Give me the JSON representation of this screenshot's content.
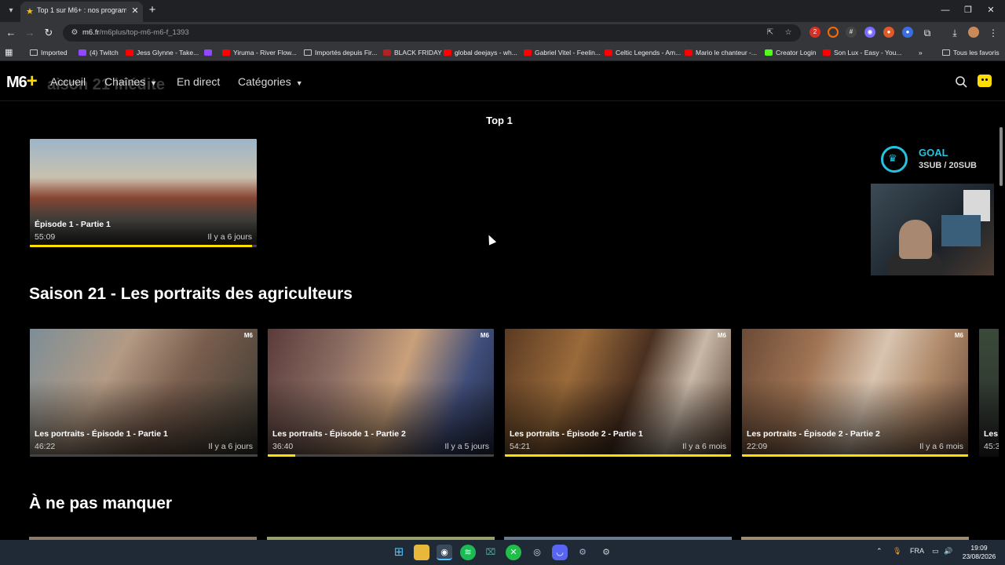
{
  "browser": {
    "tab_title": "Top 1 sur M6+ : nos programmes",
    "url_host": "m6.fr",
    "url_path": "/m6plus/top-m6-m6-f_1393",
    "bookmarks": [
      "Imported",
      "(4) Twitch",
      "Jess Glynne - Take...",
      "Yiruma - River Flow...",
      "Importés depuis Fir...",
      "BLACK FRIDAY",
      "global deejays - wh...",
      "Gabriel Vitel - Feelin...",
      "Celtic Legends - Am...",
      "Mario le chanteur -...",
      "Creator Login",
      "Son Lux - Easy - You..."
    ],
    "all_bookmarks": "Tous les favoris",
    "ext_badge": "2"
  },
  "site": {
    "logo": "M6",
    "ghost_text": "aison 21 inédite",
    "nav": {
      "home": "Accueil",
      "channels": "Chaînes",
      "live": "En direct",
      "categories": "Catégories"
    }
  },
  "top": {
    "title": "Top 1",
    "card": {
      "title": "Épisode 1 - Partie 1",
      "duration": "55:09",
      "age": "Il y a 6 jours",
      "progress": 0.98
    }
  },
  "section1": {
    "title": "Saison 21 - Les portraits des agriculteurs",
    "cards": [
      {
        "title": "Les portraits - Épisode 1 - Partie 1",
        "duration": "46:22",
        "age": "Il y a 6 jours",
        "progress": 0.0
      },
      {
        "title": "Les portraits - Épisode 1 - Partie 2",
        "duration": "36:40",
        "age": "Il y a 5 jours",
        "progress": 0.12
      },
      {
        "title": "Les portraits - Épisode 2 - Partie 1",
        "duration": "54:21",
        "age": "Il y a 6 mois",
        "progress": 1.0
      },
      {
        "title": "Les portraits - Épisode 2 - Partie 2",
        "duration": "22:09",
        "age": "Il y a 6 mois",
        "progress": 1.0
      }
    ],
    "partial_title": "Les",
    "partial_duration": "45:3"
  },
  "section2": {
    "title": "À ne pas manquer"
  },
  "overlay": {
    "goal_label": "GOAL",
    "goal_value": "3SUB / 20SUB"
  },
  "taskbar": {
    "lang": "FRA",
    "time": "19:09",
    "date": "23/08/2026"
  }
}
